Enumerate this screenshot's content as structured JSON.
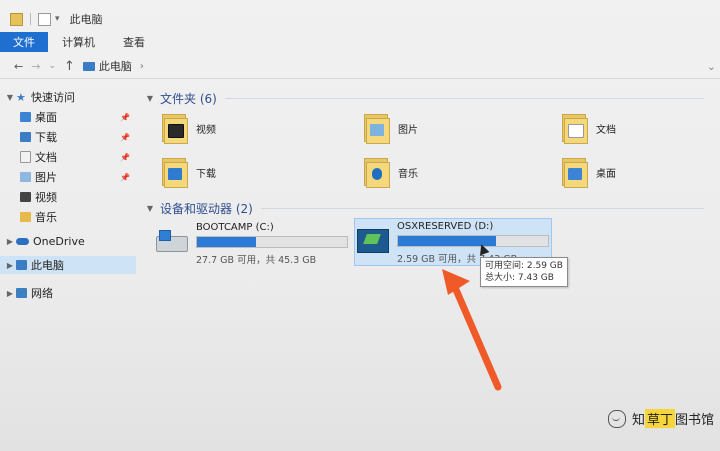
{
  "window": {
    "title": "此电脑"
  },
  "ribbon": {
    "file_tab": "文件",
    "tabs": [
      "计算机",
      "查看"
    ]
  },
  "nav": {
    "back": "←",
    "forward": "→",
    "dropdown": "⌄",
    "up": "↑",
    "breadcrumb": "此电脑",
    "chevron": "›"
  },
  "sidebar": {
    "quick_access": "快速访问",
    "items": [
      {
        "label": "桌面",
        "icon": "desktop-icon",
        "pinned": true
      },
      {
        "label": "下载",
        "icon": "download-icon",
        "pinned": true
      },
      {
        "label": "文档",
        "icon": "document-icon",
        "pinned": true
      },
      {
        "label": "图片",
        "icon": "picture-icon",
        "pinned": true
      },
      {
        "label": "视频",
        "icon": "video-icon",
        "pinned": false
      },
      {
        "label": "音乐",
        "icon": "music-icon",
        "pinned": false
      }
    ],
    "onedrive": "OneDrive",
    "this_pc": "此电脑",
    "network": "网络"
  },
  "folders_section": {
    "title": "文件夹 (6)",
    "items": [
      {
        "label": "视频",
        "badge": "video"
      },
      {
        "label": "图片",
        "badge": "pic"
      },
      {
        "label": "文档",
        "badge": "doc"
      },
      {
        "label": "下载",
        "badge": "down"
      },
      {
        "label": "音乐",
        "badge": "music"
      },
      {
        "label": "桌面",
        "badge": "desk"
      }
    ]
  },
  "drives_section": {
    "title": "设备和驱动器 (2)",
    "drives": [
      {
        "name": "BOOTCAMP (C:)",
        "usage_text": "27.7 GB 可用，共 45.3 GB",
        "used_fraction": 0.39
      },
      {
        "name": "OSXRESERVED (D:)",
        "usage_text": "2.59 GB 可用，共 7.43 GB",
        "used_fraction": 0.65
      }
    ]
  },
  "tooltip": {
    "line1": "可用空间: 2.59 GB",
    "line2": "总大小: 7.43 GB"
  },
  "watermark": {
    "prefix": "知",
    "highlight": "草丁",
    "suffix": "图书馆"
  },
  "colors": {
    "accent": "#1f6fd0",
    "bar_fill": "#2b7bd6",
    "arrow": "#f05a28"
  }
}
